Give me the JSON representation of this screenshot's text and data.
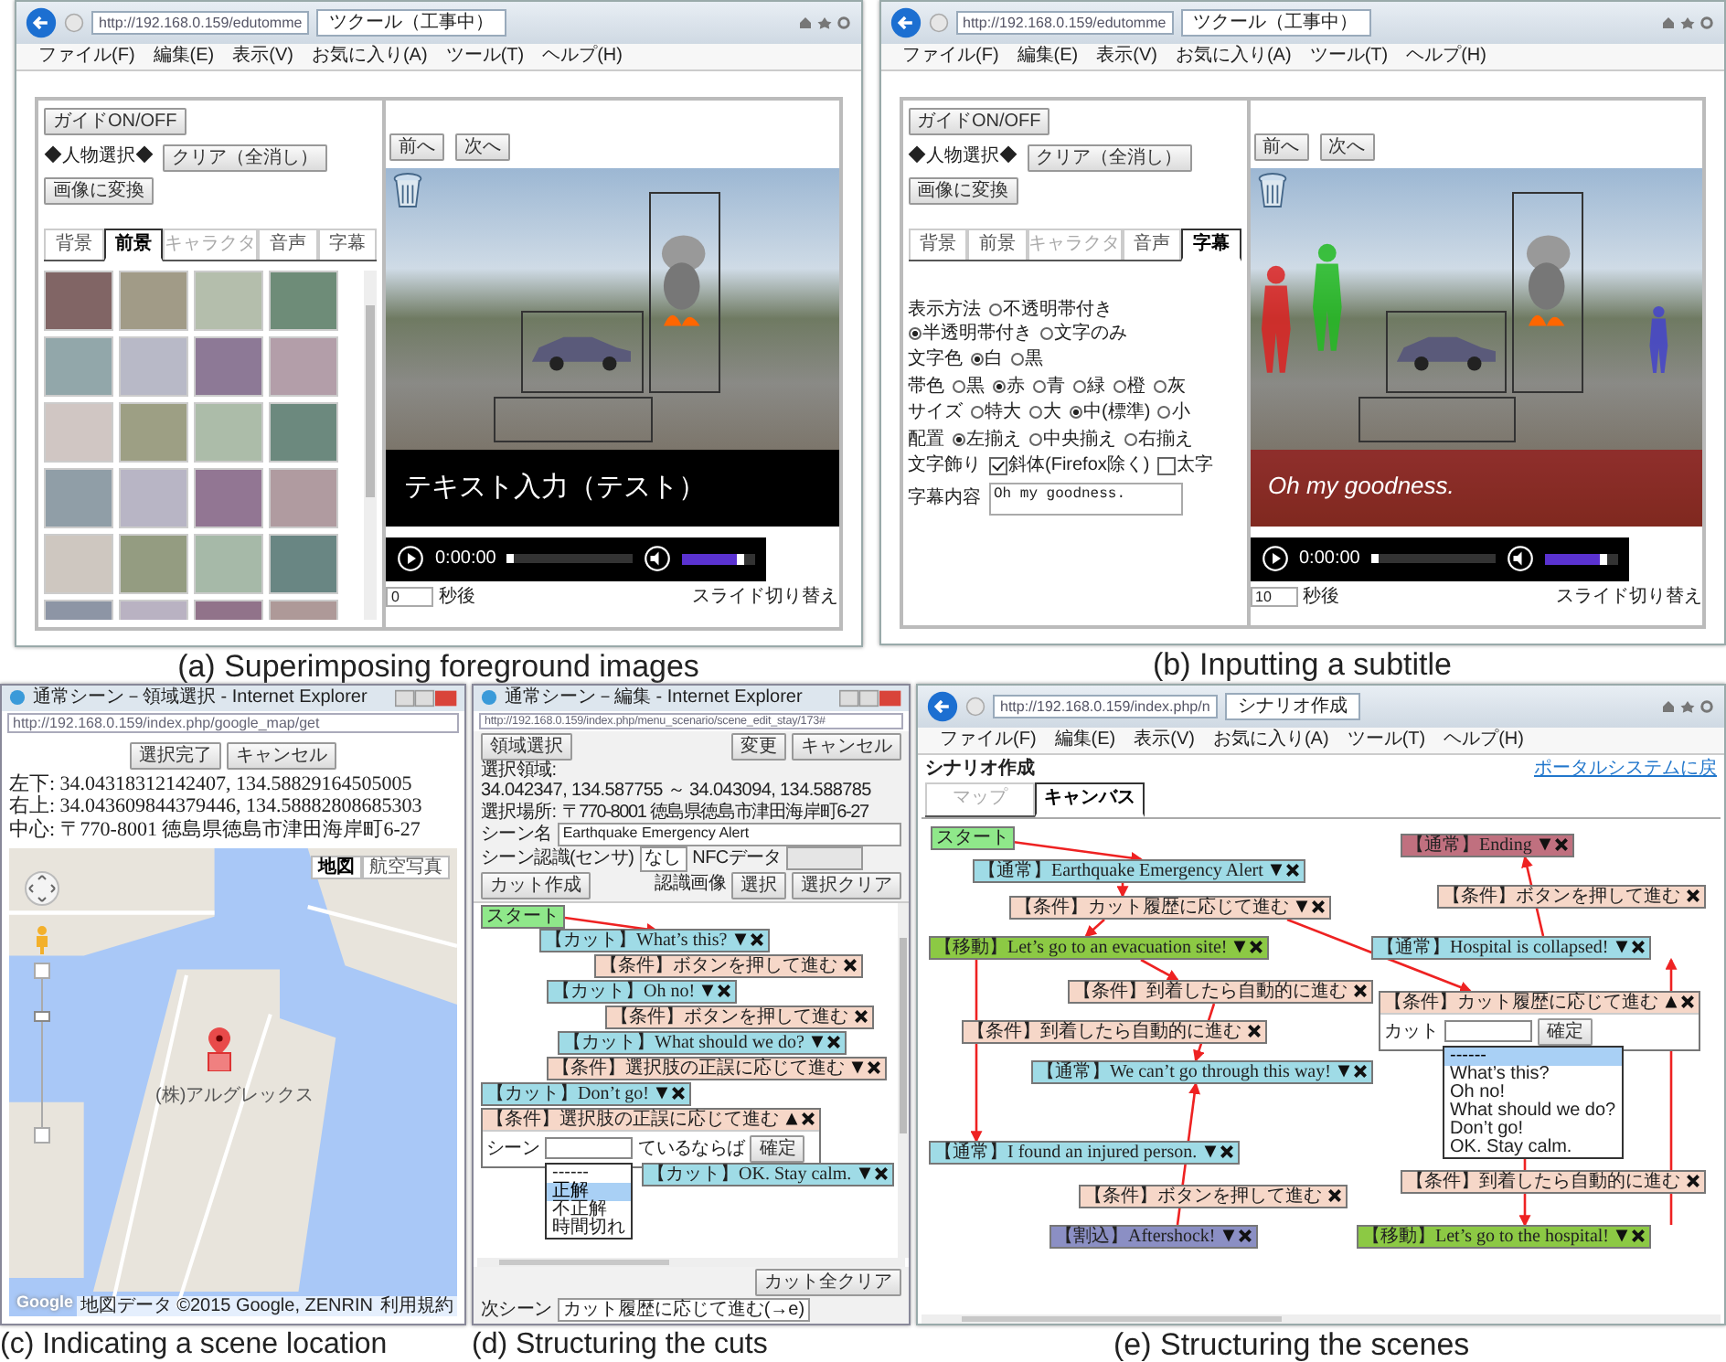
{
  "panel_a": {
    "caption": "(a) Superimposing foreground images",
    "browser": {
      "url": "http://192.168.0.159/edutomme",
      "tab": "ツクール（工事中）",
      "menu": [
        "ファイル(F)",
        "編集(E)",
        "表示(V)",
        "お気に入り(A)",
        "ツール(T)",
        "ヘルプ(H)"
      ]
    },
    "guide_button": "ガイドON/OFF",
    "person_label": "◆人物選択◆",
    "clear_button": "クリア（全消し）",
    "convert_button": "画像に変換",
    "tabs": [
      {
        "label": "背景",
        "selected": false,
        "disabled": false
      },
      {
        "label": "前景",
        "selected": true,
        "disabled": false
      },
      {
        "label": "キャラクタ",
        "selected": false,
        "disabled": true
      },
      {
        "label": "音声",
        "selected": false,
        "disabled": false
      },
      {
        "label": "字幕",
        "selected": false,
        "disabled": false
      }
    ],
    "prev_button": "前へ",
    "next_button": "次へ",
    "subtitle": "テキスト入力（テスト）",
    "player": {
      "time": "0:00:00",
      "position": {
        "level": 0.03
      },
      "volume": {
        "level": 0.85
      }
    },
    "seconds": "0",
    "seconds_unit": "秒後",
    "slide_switch": "スライド切り替え"
  },
  "panel_b": {
    "caption": "(b) Inputting a subtitle",
    "browser": {
      "url": "http://192.168.0.159/edutomme",
      "tab": "ツクール（工事中）",
      "menu": [
        "ファイル(F)",
        "編集(E)",
        "表示(V)",
        "お気に入り(A)",
        "ツール(T)",
        "ヘルプ(H)"
      ]
    },
    "guide_button": "ガイドON/OFF",
    "person_label": "◆人物選択◆",
    "clear_button": "クリア（全消し）",
    "convert_button": "画像に変換",
    "tabs": [
      {
        "label": "背景",
        "selected": false,
        "disabled": false
      },
      {
        "label": "前景",
        "selected": false,
        "disabled": false
      },
      {
        "label": "キャラクタ",
        "selected": false,
        "disabled": true
      },
      {
        "label": "音声",
        "selected": false,
        "disabled": false
      },
      {
        "label": "字幕",
        "selected": true,
        "disabled": false
      }
    ],
    "subtitle_form": {
      "rows": [
        {
          "label": "表示方法",
          "kind": "radio",
          "options": [
            {
              "label": "不透明帯付き",
              "selected": false
            },
            {
              "label": "半透明帯付き",
              "selected": true
            },
            {
              "label": "文字のみ",
              "selected": false
            }
          ]
        },
        {
          "label": "文字色",
          "kind": "radio",
          "options": [
            {
              "label": "白",
              "selected": true
            },
            {
              "label": "黒",
              "selected": false
            }
          ]
        },
        {
          "label": "帯色",
          "kind": "radio",
          "options": [
            {
              "label": "黒",
              "selected": false
            },
            {
              "label": "赤",
              "selected": true
            },
            {
              "label": "青",
              "selected": false
            },
            {
              "label": "緑",
              "selected": false
            },
            {
              "label": "橙",
              "selected": false
            },
            {
              "label": "灰",
              "selected": false
            }
          ]
        },
        {
          "label": "サイズ",
          "kind": "radio",
          "options": [
            {
              "label": "特大",
              "selected": false
            },
            {
              "label": "大",
              "selected": false
            },
            {
              "label": "中(標準)",
              "selected": true
            },
            {
              "label": "小",
              "selected": false
            }
          ]
        },
        {
          "label": "配置",
          "kind": "radio",
          "options": [
            {
              "label": "左揃え",
              "selected": true
            },
            {
              "label": "中央揃え",
              "selected": false
            },
            {
              "label": "右揃え",
              "selected": false
            }
          ]
        },
        {
          "label": "文字飾り",
          "kind": "checkbox",
          "options": [
            {
              "label": "斜体(Firefox除く)",
              "checked": true
            },
            {
              "label": "太字",
              "checked": false
            }
          ]
        },
        {
          "label": "字幕内容",
          "kind": "text",
          "value": "Oh my goodness."
        }
      ]
    },
    "prev_button": "前へ",
    "next_button": "次へ",
    "subtitle": "Oh my goodness.",
    "player": {
      "time": "0:00:00",
      "position": {
        "level": 0.03
      },
      "volume": {
        "level": 0.85
      }
    },
    "seconds": "10",
    "seconds_unit": "秒後",
    "slide_switch": "スライド切り替え"
  },
  "panel_c": {
    "caption": "(c) Indicating a scene location",
    "title": "通常シーン－領域選択 - Internet Explorer",
    "url": "http://192.168.0.159/index.php/google_map/get",
    "done_button": "選択完了",
    "cancel_button": "キャンセル",
    "coordinates": [
      "左下: 34.04318312142407, 134.58829164505005",
      "右上: 34.043609844379446, 134.58882808685303",
      "中心: 〒770-8001 徳島県徳島市津田海岸町6-27"
    ],
    "map_types": [
      {
        "label": "地図",
        "selected": true
      },
      {
        "label": "航空写真",
        "selected": false
      }
    ],
    "zoom_slider": {
      "level": 0.7
    },
    "map_label": "(株)アルグレックス",
    "logo": "Google",
    "map_footer": "地図データ ©2015 Google, ZENRIN",
    "terms_link": "利用規約"
  },
  "panel_d": {
    "caption": "(d) Structuring the cuts",
    "title": "通常シーン－編集 - Internet Explorer",
    "url": "http://192.168.0.159/index.php/menu_scenario/scene_edit_stay/173#",
    "change_button": "変更",
    "cancel_button": "キャンセル",
    "area_label": "選択領域:",
    "area_value": "34.042347, 134.587755 ～ 34.043094, 134.588785",
    "place_label": "選択場所:",
    "place_value": "〒770-8001 徳島県徳島市津田海岸町6-27",
    "area_button": "領域選択",
    "scene_name_label": "シーン名",
    "scene_name": "Earthquake Emergency Alert",
    "sensor_label": "シーン認識(センサ)",
    "sensor_value": "なし",
    "nfc_label": "NFCデータ",
    "image_label": "認識画像",
    "select_button": "選択",
    "create_cut_button": "カット作成",
    "clear_selection_button": "選択クリア",
    "canvas": {
      "nodes": [
        {
          "kind": "start",
          "text": "スタート"
        },
        {
          "kind": "cut",
          "text": "【カット】What’s this?",
          "expanded": false
        },
        {
          "kind": "condition",
          "text": "【条件】ボタンを押して進む"
        },
        {
          "kind": "cut",
          "text": "【カット】Oh no!",
          "expanded": false
        },
        {
          "kind": "condition",
          "text": "【条件】ボタンを押して進む"
        },
        {
          "kind": "cut",
          "text": "【カット】What should we do?",
          "expanded": false
        },
        {
          "kind": "branch",
          "text": "【条件】選択肢の正誤に応じて進む",
          "expanded": false
        },
        {
          "kind": "cut",
          "text": "【カット】Don’t go!",
          "expanded": false
        },
        {
          "kind": "branch",
          "text": "【条件】選択肢の正誤に応じて進む",
          "expanded": true,
          "body": {
            "label": "シーン",
            "suffix": "ているならば",
            "confirm": "確定",
            "options": [
              {
                "label": "------",
                "selected": false
              },
              {
                "label": "正解",
                "selected": true
              },
              {
                "label": "不正解",
                "selected": false
              },
              {
                "label": "時間切れ",
                "selected": false
              }
            ]
          }
        },
        {
          "kind": "cut",
          "text": "【カット】OK. Stay calm.",
          "expanded": false
        }
      ]
    },
    "clear_all_button": "カット全クリア",
    "next_scene_label": "次シーン",
    "next_scene_value": "カット履歴に応じて進む(→e)"
  },
  "panel_e": {
    "caption": "(e) Structuring the scenes",
    "browser": {
      "url": "http://192.168.0.159/index.php/n",
      "tab": "シナリオ作成",
      "menu": [
        "ファイル(F)",
        "編集(E)",
        "表示(V)",
        "お気に入り(A)",
        "ツール(T)",
        "ヘルプ(H)"
      ]
    },
    "heading": "シナリオ作成",
    "portal_link": "ポータルシステムに戻",
    "tabs": [
      {
        "label": "マップ",
        "selected": false,
        "disabled": true
      },
      {
        "label": "キャンバス",
        "selected": true,
        "disabled": false
      }
    ],
    "canvas": {
      "nodes": [
        {
          "kind": "start",
          "text": "スタート",
          "color": "#8fe88a"
        },
        {
          "kind": "scene",
          "text": "【通常】Earthquake Emergency Alert",
          "expanded": false,
          "color": "#9fdbe6"
        },
        {
          "kind": "branch",
          "text": "【条件】カット履歴に応じて進む",
          "expanded": false,
          "color": "#f6d7c8"
        },
        {
          "kind": "scene",
          "text": "【移動】Let’s go to an evacuation site!",
          "expanded": false,
          "color": "#8cc944"
        },
        {
          "kind": "condition",
          "text": "【条件】到着したら自動的に進む",
          "color": "#f6d7c8"
        },
        {
          "kind": "condition",
          "text": "【条件】到着したら自動的に進む",
          "color": "#f6d7c8"
        },
        {
          "kind": "scene",
          "text": "【通常】We can’t go through this way!",
          "expanded": false,
          "color": "#9fdbe6"
        },
        {
          "kind": "scene",
          "text": "【通常】I found an injured person.",
          "expanded": false,
          "color": "#9fdbe6"
        },
        {
          "kind": "condition",
          "text": "【条件】ボタンを押して進む",
          "color": "#f6d7c8"
        },
        {
          "kind": "scene",
          "text": "【割込】Aftershock!",
          "expanded": false,
          "color": "#8b8fc4"
        },
        {
          "kind": "scene",
          "text": "【通常】Ending",
          "expanded": false,
          "color": "#c0707f"
        },
        {
          "kind": "condition",
          "text": "【条件】ボタンを押して進む",
          "color": "#f6d7c8"
        },
        {
          "kind": "scene",
          "text": "【通常】Hospital is collapsed!",
          "expanded": false,
          "color": "#9fdbe6"
        },
        {
          "kind": "branch",
          "text": "【条件】カット履歴に応じて進む",
          "expanded": true,
          "color": "#f6d7c8",
          "body": {
            "label": "カット",
            "confirm": "確定",
            "options": [
              {
                "label": "------",
                "selected": true
              },
              {
                "label": "What’s this?",
                "selected": false
              },
              {
                "label": "Oh no!",
                "selected": false
              },
              {
                "label": "What should we do?",
                "selected": false
              },
              {
                "label": "Don’t go!",
                "selected": false
              },
              {
                "label": "OK. Stay calm.",
                "selected": false
              }
            ]
          }
        },
        {
          "kind": "condition",
          "text": "【条件】到着したら自動的に進む",
          "color": "#f6d7c8"
        },
        {
          "kind": "scene",
          "text": "【移動】Let’s go to the hospital!",
          "expanded": false,
          "color": "#8cc944"
        }
      ]
    }
  }
}
